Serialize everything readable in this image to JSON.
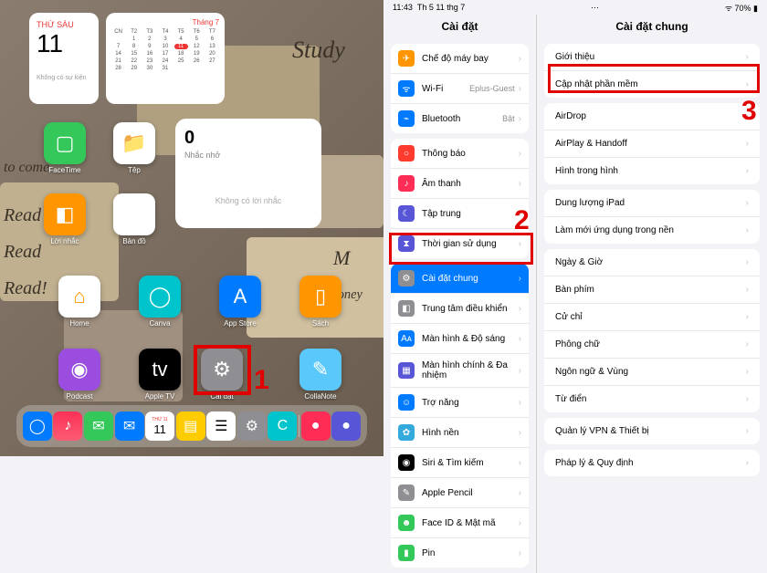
{
  "homescreen": {
    "date_widget": {
      "weekday": "THỨ SÁU",
      "day": "11",
      "no_event": "Không có sự kiện"
    },
    "calendar_widget": {
      "month_label": "Tháng 7"
    },
    "reminders_widget": {
      "count": "0",
      "title": "Nhắc nhở",
      "empty": "Không có lời nhắc"
    },
    "scripts": {
      "study": "Study",
      "tocome": "to come",
      "read1": "Read",
      "read2": "Read",
      "read3": "Read!",
      "m": "M",
      "save": "Save money"
    },
    "icons": {
      "facetime": "FaceTime",
      "files": "Tệp",
      "shortcuts": "Lời nhắc",
      "maps": "Bản đồ",
      "home": "Home",
      "goodnotes": "Canva",
      "appstore": "App Store",
      "books": "Sách",
      "podcasts": "Podcast",
      "appletv": "Apple TV",
      "settings": "Cài đặt",
      "collanote": "CollaNote"
    },
    "dock_date": {
      "weekday": "THỨ 11",
      "day": "11"
    }
  },
  "statusbar": {
    "time": "11:43",
    "date": "Th 5 11 thg 7",
    "battery": "70%"
  },
  "settings": {
    "left_title": "Cài đặt",
    "right_title": "Cài đặt chung",
    "left_groups": [
      {
        "rows": [
          {
            "icon": "✈︎",
            "color": "#ff9500",
            "label": "Chế độ máy bay",
            "value": ""
          },
          {
            "icon": "ᯤ",
            "color": "#007aff",
            "label": "Wi-Fi",
            "value": "Eplus-Guest"
          },
          {
            "icon": "⌁",
            "color": "#007aff",
            "label": "Bluetooth",
            "value": "Bật"
          }
        ]
      },
      {
        "rows": [
          {
            "icon": "○",
            "color": "#ff3b30",
            "label": "Thông báo",
            "value": ""
          },
          {
            "icon": "♪",
            "color": "#ff2d55",
            "label": "Âm thanh",
            "value": ""
          },
          {
            "icon": "☾",
            "color": "#5856d6",
            "label": "Tập trung",
            "value": ""
          },
          {
            "icon": "⧗",
            "color": "#5856d6",
            "label": "Thời gian sử dụng",
            "value": ""
          }
        ]
      },
      {
        "rows": [
          {
            "icon": "⚙",
            "color": "#8e8e93",
            "label": "Cài đặt chung",
            "value": "",
            "selected": true
          },
          {
            "icon": "◧",
            "color": "#8e8e93",
            "label": "Trung tâm điều khiển",
            "value": ""
          },
          {
            "icon": "Aᴀ",
            "color": "#007aff",
            "label": "Màn hình & Độ sáng",
            "value": ""
          },
          {
            "icon": "▦",
            "color": "#5856d6",
            "label": "Màn hình chính & Đa nhiệm",
            "value": ""
          },
          {
            "icon": "☺",
            "color": "#007aff",
            "label": "Trợ năng",
            "value": ""
          },
          {
            "icon": "✿",
            "color": "#34aadc",
            "label": "Hình nền",
            "value": ""
          },
          {
            "icon": "◉",
            "color": "#000",
            "label": "Siri & Tìm kiếm",
            "value": ""
          },
          {
            "icon": "✎",
            "color": "#8e8e93",
            "label": "Apple Pencil",
            "value": ""
          },
          {
            "icon": "☻",
            "color": "#34c759",
            "label": "Face ID & Mật mã",
            "value": ""
          },
          {
            "icon": "▮",
            "color": "#34c759",
            "label": "Pin",
            "value": ""
          }
        ]
      }
    ],
    "right_groups": [
      {
        "rows": [
          {
            "label": "Giới thiệu"
          },
          {
            "label": "Cập nhật phần mềm"
          }
        ]
      },
      {
        "rows": [
          {
            "label": "AirDrop"
          },
          {
            "label": "AirPlay & Handoff"
          },
          {
            "label": "Hình trong hình"
          }
        ]
      },
      {
        "rows": [
          {
            "label": "Dung lượng iPad"
          },
          {
            "label": "Làm mới ứng dụng trong nền"
          }
        ]
      },
      {
        "rows": [
          {
            "label": "Ngày & Giờ"
          },
          {
            "label": "Bàn phím"
          },
          {
            "label": "Cử chỉ"
          },
          {
            "label": "Phông chữ"
          },
          {
            "label": "Ngôn ngữ & Vùng"
          },
          {
            "label": "Từ điển"
          }
        ]
      },
      {
        "rows": [
          {
            "label": "Quản lý VPN & Thiết bị"
          }
        ]
      },
      {
        "rows": [
          {
            "label": "Pháp lý & Quy định"
          }
        ]
      }
    ]
  },
  "annotations": {
    "n1": "1",
    "n2": "2",
    "n3": "3"
  }
}
